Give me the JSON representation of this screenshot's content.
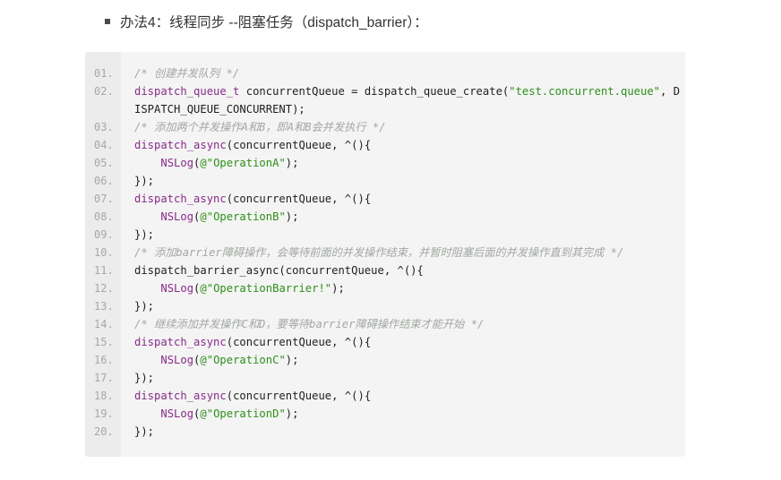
{
  "bullet": {
    "text": "办法4：线程同步 --阻塞任务（dispatch_barrier）："
  },
  "code_block": {
    "lines": [
      {
        "num": "01.",
        "tokens": [
          {
            "type": "comment",
            "text": "/* 创建并发队列 */"
          }
        ]
      },
      {
        "num": "02.",
        "tokens": [
          {
            "type": "kw",
            "text": "dispatch_queue_t"
          },
          {
            "type": "plain",
            "text": " concurrentQueue = dispatch_queue_create("
          },
          {
            "type": "str",
            "text": "\"test.concurrent.queue\""
          },
          {
            "type": "plain",
            "text": ", D"
          }
        ]
      },
      {
        "num": "",
        "tokens": [
          {
            "type": "plain",
            "text": "ISPATCH_QUEUE_CONCURRENT);"
          }
        ]
      },
      {
        "num": "03.",
        "tokens": [
          {
            "type": "comment",
            "text": "/* 添加两个并发操作A和B，即A和B会并发执行 */"
          }
        ]
      },
      {
        "num": "04.",
        "tokens": [
          {
            "type": "kw",
            "text": "dispatch_async"
          },
          {
            "type": "plain",
            "text": "(concurrentQueue, ^(){"
          }
        ]
      },
      {
        "num": "05.",
        "tokens": [
          {
            "type": "plain",
            "text": "    "
          },
          {
            "type": "kw",
            "text": "NSLog"
          },
          {
            "type": "plain",
            "text": "("
          },
          {
            "type": "str",
            "text": "@\"OperationA\""
          },
          {
            "type": "plain",
            "text": ");"
          }
        ]
      },
      {
        "num": "06.",
        "tokens": [
          {
            "type": "plain",
            "text": "});"
          }
        ]
      },
      {
        "num": "07.",
        "tokens": [
          {
            "type": "kw",
            "text": "dispatch_async"
          },
          {
            "type": "plain",
            "text": "(concurrentQueue, ^(){"
          }
        ]
      },
      {
        "num": "08.",
        "tokens": [
          {
            "type": "plain",
            "text": "    "
          },
          {
            "type": "kw",
            "text": "NSLog"
          },
          {
            "type": "plain",
            "text": "("
          },
          {
            "type": "str",
            "text": "@\"OperationB\""
          },
          {
            "type": "plain",
            "text": ");"
          }
        ]
      },
      {
        "num": "09.",
        "tokens": [
          {
            "type": "plain",
            "text": "});"
          }
        ]
      },
      {
        "num": "10.",
        "tokens": [
          {
            "type": "comment",
            "text": "/* 添加barrier障碍操作，会等待前面的并发操作结束，并暂时阻塞后面的并发操作直到其完成 */"
          }
        ]
      },
      {
        "num": "11.",
        "tokens": [
          {
            "type": "plain",
            "text": "dispatch_barrier_async(concurrentQueue, ^(){"
          }
        ]
      },
      {
        "num": "12.",
        "tokens": [
          {
            "type": "plain",
            "text": "    "
          },
          {
            "type": "kw",
            "text": "NSLog"
          },
          {
            "type": "plain",
            "text": "("
          },
          {
            "type": "str",
            "text": "@\"OperationBarrier!\""
          },
          {
            "type": "plain",
            "text": ");"
          }
        ]
      },
      {
        "num": "13.",
        "tokens": [
          {
            "type": "plain",
            "text": "});"
          }
        ]
      },
      {
        "num": "14.",
        "tokens": [
          {
            "type": "comment",
            "text": "/* 继续添加并发操作C和D，要等待barrier障碍操作结束才能开始 */"
          }
        ]
      },
      {
        "num": "15.",
        "tokens": [
          {
            "type": "kw",
            "text": "dispatch_async"
          },
          {
            "type": "plain",
            "text": "(concurrentQueue, ^(){"
          }
        ]
      },
      {
        "num": "16.",
        "tokens": [
          {
            "type": "plain",
            "text": "    "
          },
          {
            "type": "kw",
            "text": "NSLog"
          },
          {
            "type": "plain",
            "text": "("
          },
          {
            "type": "str",
            "text": "@\"OperationC\""
          },
          {
            "type": "plain",
            "text": ");"
          }
        ]
      },
      {
        "num": "17.",
        "tokens": [
          {
            "type": "plain",
            "text": "});"
          }
        ]
      },
      {
        "num": "18.",
        "tokens": [
          {
            "type": "kw",
            "text": "dispatch_async"
          },
          {
            "type": "plain",
            "text": "(concurrentQueue, ^(){"
          }
        ]
      },
      {
        "num": "19.",
        "tokens": [
          {
            "type": "plain",
            "text": "    "
          },
          {
            "type": "kw",
            "text": "NSLog"
          },
          {
            "type": "plain",
            "text": "("
          },
          {
            "type": "str",
            "text": "@\"OperationD\""
          },
          {
            "type": "plain",
            "text": ");"
          }
        ]
      },
      {
        "num": "20.",
        "tokens": [
          {
            "type": "plain",
            "text": "});"
          }
        ]
      }
    ]
  },
  "colors": {
    "keyword": "#8a2b8a",
    "string": "#2f8f1a",
    "comment": "#a3a7a3",
    "code_background": "#f3f4f3",
    "gutter_background": "#ebeceb"
  }
}
